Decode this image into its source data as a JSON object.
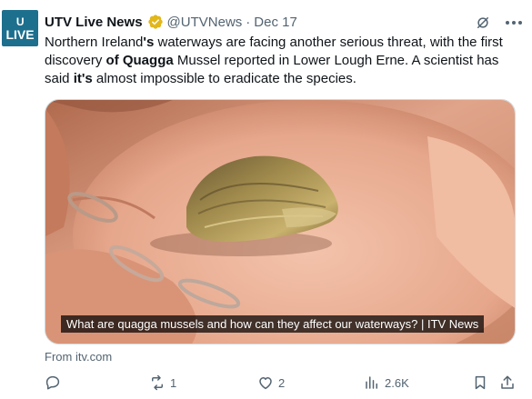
{
  "account": {
    "avatar_top": "U",
    "avatar_label": "LIVE",
    "display_name": "UTV Live News",
    "handle": "@UTVNews",
    "separator": "·",
    "date": "Dec 17"
  },
  "tweet": {
    "text_parts": [
      "Northern Ireland",
      "'s",
      " waterways are facing another serious threat, with the first discovery ",
      "of Quagga",
      " Mussel reported in Lower Lough Erne. A scientist has said ",
      "it's",
      " almost impossible to eradicate the species."
    ]
  },
  "media": {
    "caption": "What are quagga mussels and how can they affect our waterways? | ITV News"
  },
  "link_source": "From itv.com",
  "actions": {
    "reply_count": "",
    "retweet_count": "1",
    "like_count": "2",
    "views_count": "2.6K"
  },
  "colors": {
    "avatar_bg": "#1d6f8e",
    "verified_gold": "#e2b719",
    "secondary_text": "#536471"
  },
  "icons": [
    "grok-icon",
    "more-icon",
    "verified-badge-icon",
    "reply-icon",
    "retweet-icon",
    "like-icon",
    "views-icon",
    "bookmark-icon",
    "share-icon"
  ]
}
